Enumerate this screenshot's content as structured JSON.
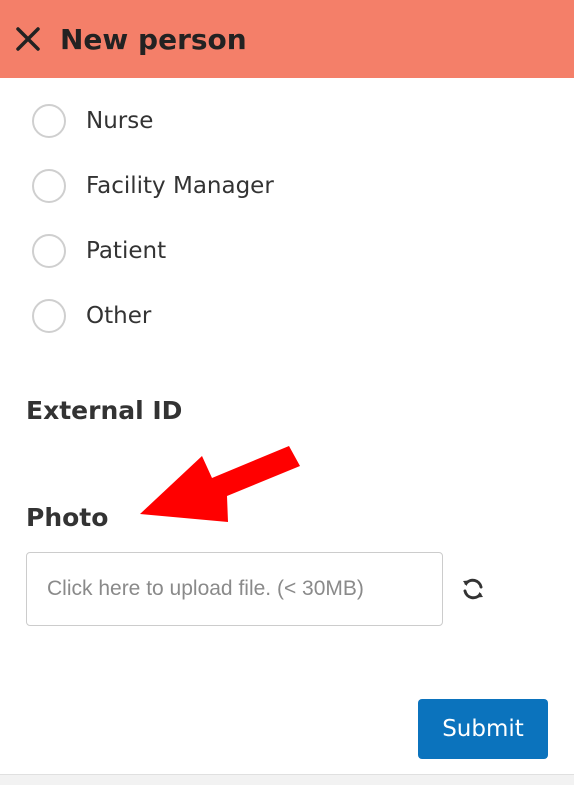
{
  "header": {
    "title": "New person"
  },
  "radio_options": [
    {
      "label": "Nurse"
    },
    {
      "label": "Facility Manager"
    },
    {
      "label": "Patient"
    },
    {
      "label": "Other"
    }
  ],
  "fields": {
    "external_id_label": "External ID",
    "photo_label": "Photo",
    "upload_placeholder": "Click here to upload file. (< 30MB)"
  },
  "actions": {
    "submit_label": "Submit"
  },
  "colors": {
    "header_bg": "#f47f69",
    "submit_bg": "#0b73bd",
    "annotation_arrow": "#ff0000"
  },
  "icons": {
    "close": "close-icon",
    "refresh": "refresh-icon",
    "annotation": "red-arrow-icon"
  }
}
